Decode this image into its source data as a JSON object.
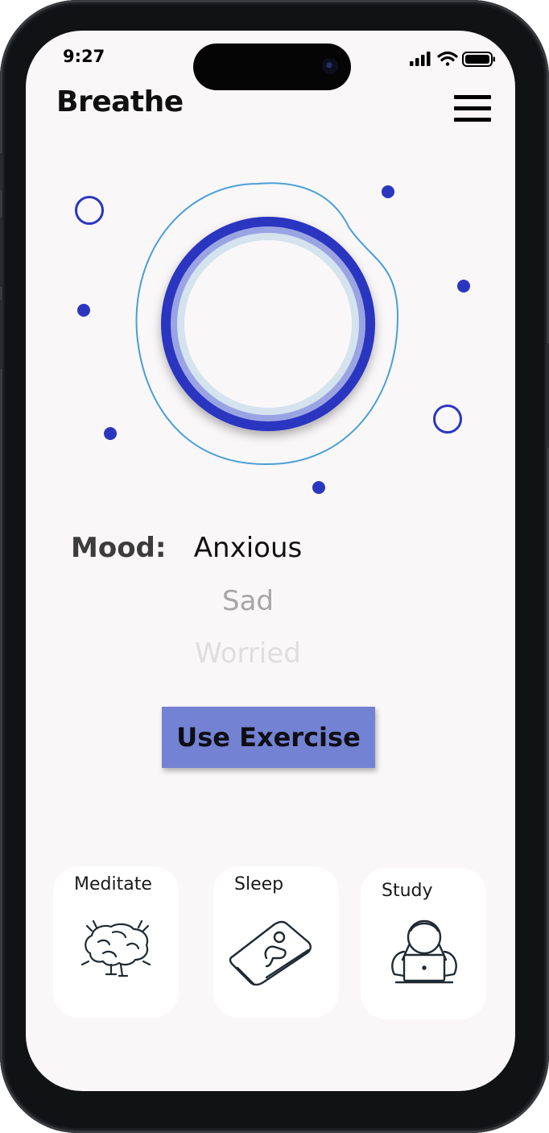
{
  "status_bar": {
    "time": "9:27"
  },
  "header": {
    "title": "Breathe"
  },
  "mood": {
    "label": "Mood:",
    "options": [
      "Anxious",
      "Sad",
      "Worried"
    ],
    "selected": "Anxious"
  },
  "action": {
    "exercise_label": "Use Exercise"
  },
  "categories": [
    {
      "label": "Meditate",
      "icon": "brain-icon"
    },
    {
      "label": "Sleep",
      "icon": "sleep-icon"
    },
    {
      "label": "Study",
      "icon": "study-laptop-icon"
    }
  ],
  "colors": {
    "accent": "#2b36c0",
    "button": "#7382d2",
    "blob_outline": "#4a9fd6",
    "screen_bg": "#f9f7f8"
  }
}
